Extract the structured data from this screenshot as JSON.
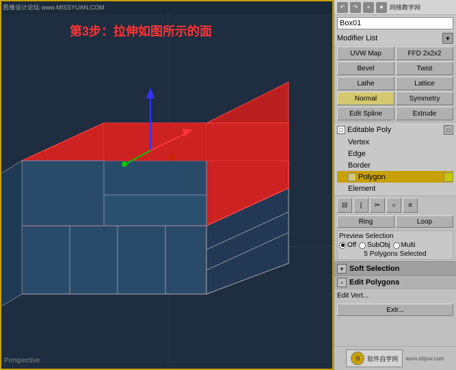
{
  "viewport": {
    "label": "Perspective",
    "background_color": "#1e2d40"
  },
  "instruction": {
    "text": "第3步：拉伸如图所示的面"
  },
  "watermark": {
    "site": "思维设计论坛",
    "url": "www.MISSYUAN.COM",
    "logo_url": "www.ebjxw.com"
  },
  "right_panel": {
    "object_name": "Box01",
    "modifier_list_label": "Modifier List",
    "nav_icons": [
      "↶",
      "↷",
      "⊕",
      "☆"
    ],
    "modifier_buttons": [
      {
        "label": "UVW Map",
        "highlighted": false
      },
      {
        "label": "FFD 2x2x2",
        "highlighted": false
      },
      {
        "label": "Bevel",
        "highlighted": false
      },
      {
        "label": "Twist",
        "highlighted": false
      },
      {
        "label": "Lathe",
        "highlighted": false
      },
      {
        "label": "Lattice",
        "highlighted": false
      },
      {
        "label": "Normal",
        "highlighted": true
      },
      {
        "label": "Symmetry",
        "highlighted": false
      },
      {
        "label": "Edit Spline",
        "highlighted": false
      },
      {
        "label": "Extrude",
        "highlighted": false
      }
    ],
    "stack": {
      "root_label": "Editable Poly",
      "items": [
        {
          "label": "Vertex",
          "selected": false
        },
        {
          "label": "Edge",
          "selected": false
        },
        {
          "label": "Border",
          "selected": false
        },
        {
          "label": "Polygon",
          "selected": true
        },
        {
          "label": "Element",
          "selected": false
        }
      ]
    },
    "toolbar_icons": [
      "⊟",
      "⊞",
      "✂",
      "○",
      "☰"
    ],
    "ring_loop": {
      "ring_label": "Ring",
      "loop_label": "Loop"
    },
    "preview_selection": {
      "title": "Preview Selection",
      "options": [
        "Off",
        "SubObj",
        "Multi"
      ],
      "active": "Off",
      "status": "5 Polygons Selected"
    },
    "soft_selection": {
      "sign": "+",
      "label": "Soft Selection"
    },
    "edit_polygons": {
      "sign": "-",
      "label": "Edit Polygons"
    },
    "edit_verts": {
      "label": "Edit Vert..."
    },
    "extrude": {
      "label": "Extr..."
    }
  }
}
